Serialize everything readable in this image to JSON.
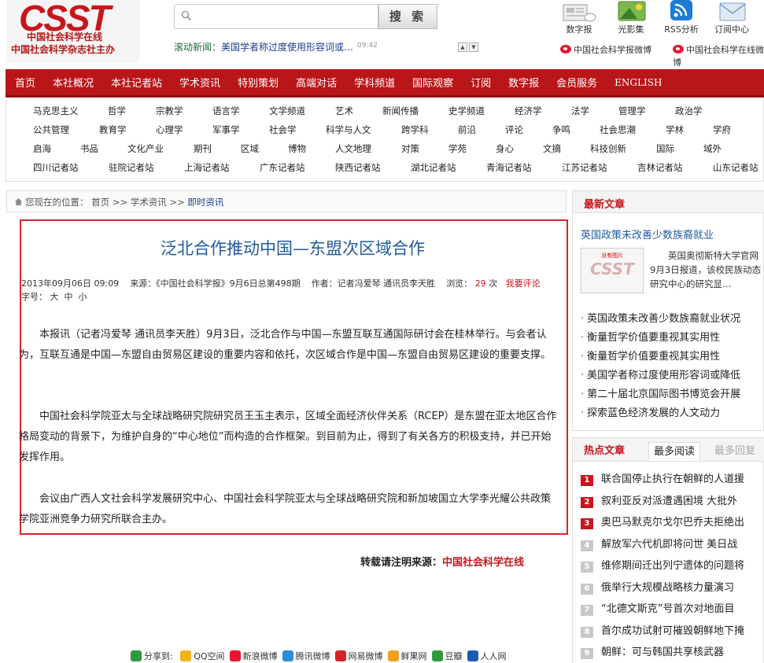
{
  "header": {
    "logo_text": "CSST",
    "logo_sub1": "中国社会科学在线",
    "logo_sub2": "中国社会科学杂志社主办",
    "search_placeholder": "",
    "search_button": "搜 索",
    "ticker_label": "滚动新闻：",
    "ticker_text": "美国学者称过度使用形容词或…",
    "ticker_time": "09:42",
    "top_icons": [
      {
        "icon": "newspaper-icon",
        "label": "数字报"
      },
      {
        "icon": "photo-icon",
        "label": "光影集"
      },
      {
        "icon": "rss-icon",
        "label": "RSS分析"
      },
      {
        "icon": "mail-icon",
        "label": "订阅中心"
      }
    ],
    "weibo_links": [
      "中国社会科学报微博",
      "中国社会科学在线微博"
    ]
  },
  "main_nav": [
    "首页",
    "本社概况",
    "本社记者站",
    "学术资讯",
    "特别策划",
    "高端对话",
    "学科频道",
    "国际观察",
    "订阅",
    "数字报",
    "会员服务",
    "ENGLISH"
  ],
  "sub_nav": {
    "row1": [
      "马克思主义",
      "哲学",
      "宗教学",
      "语言学",
      "文学频道",
      "艺术",
      "新闻传播",
      "史学频道",
      "经济学",
      "法学",
      "管理学",
      "政治学"
    ],
    "row2": [
      "公共管理",
      "教育学",
      "心理学",
      "军事学",
      "社会学",
      "科学与人文",
      "跨学科",
      "前沿",
      "评论",
      "争鸣",
      "社会思潮",
      "学林",
      "学府"
    ],
    "row3": [
      "启海",
      "书品",
      "文化产业",
      "期刊",
      "区域",
      "博物",
      "人文地理",
      "对策",
      "学苑",
      "身心",
      "文摘",
      "科技创新",
      "国际",
      "域外"
    ],
    "row4": [
      "四川记者站",
      "驻院记者站",
      "上海记者站",
      "广东记者站",
      "陕西记者站",
      "湖北记者站",
      "青海记者站",
      "江苏记者站",
      "吉林记者站",
      "山东记者站"
    ]
  },
  "breadcrumb": {
    "prefix": "您现在的位置：",
    "home": "首页",
    "sep1": ">>",
    "section": "学术资讯",
    "sep2": ">>",
    "current": "即时资讯"
  },
  "article": {
    "title": "泛北合作推动中国—东盟次区域合作",
    "date": "2013年09月06日 09:09",
    "source": "来源：《中国社会科学报》9月6日总第498期",
    "author": "作者：记者冯爱琴 通讯员李天胜",
    "views_label": "浏览：",
    "views": "29",
    "views_unit": "次",
    "comment_link": "我要评论",
    "fontsize_label": "字号：",
    "fontsize_options": [
      "大",
      "中",
      "小"
    ],
    "paragraphs": [
      "本报讯（记者冯爱琴 通讯员李天胜）9月3日，泛北合作与中国—东盟互联互通国际研讨会在桂林举行。与会者认为，互联互通是中国—东盟自由贸易区建设的重要内容和依托，次区域合作是中国—东盟自由贸易区建设的重要支撑。",
      "中国社会科学院亚太与全球战略研究院研究员王玉主表示，区域全面经济伙伴关系（RCEP）是东盟在亚太地区合作格局变动的背景下，为维护自身的“中心地位”而构造的合作框架。到目前为止，得到了有关各方的积极支持，并已开始发挥作用。",
      "会议由广西人文社会科学发展研究中心、中国社会科学院亚太与全球战略研究院和新加坡国立大学李光耀公共政策学院亚洲竞争力研究所联合主办。"
    ],
    "repost_label": "转载请注明来源：",
    "repost_source": "中国社会科学在线"
  },
  "share": {
    "label": "分享到:",
    "items": [
      {
        "name": "QQ空间",
        "color": "#f2b315"
      },
      {
        "name": "新浪微博",
        "color": "#e6162d"
      },
      {
        "name": "腾讯微博",
        "color": "#2b8ed6"
      },
      {
        "name": "网易微博",
        "color": "#d5242b"
      },
      {
        "name": "鲜果网",
        "color": "#f0a020"
      },
      {
        "name": "豆瓣",
        "color": "#2f9a3b"
      },
      {
        "name": "人人网",
        "color": "#1b5cae"
      }
    ]
  },
  "latest": {
    "title": "最新文章",
    "featured_title": "英国政策未改善少数族裔就业",
    "thumb_text": "没有图片",
    "thumb_logo": "CSST",
    "featured_desc": "英国奥彻斯特大学官网9月3日报道，该校民族动态研究中心的研究显…",
    "items": [
      "英国政策未改善少数族裔就业状况",
      "衡量哲学价值要重视其实用性",
      "衡量哲学价值要重视其实用性",
      "美国学者称过度使用形容词或降低",
      "第二十届北京国际图书博览会开展",
      "探索蓝色经济发展的人文动力"
    ]
  },
  "hot": {
    "title": "热点文章",
    "tabs": [
      "最多阅读",
      "最多回复"
    ],
    "items": [
      "联合国停止执行在朝鲜的人道援",
      "叙利亚反对派遭遇困境 大批外",
      "奥巴马默克尔戈尔巴乔夫拒绝出",
      "解放军六代机即将问世 美日战",
      "维修期间迁出列宁遗体的问题将",
      "俄举行大规模战略核力量演习",
      "“北德文斯克”号首次对地面目",
      "首尔成功试射可摧毁朝鲜地下掩",
      "朝鲜：可与韩国共享核武器"
    ],
    "nums": [
      "1",
      "2",
      "3",
      "4",
      "5",
      "6",
      "7",
      "8",
      "9"
    ]
  },
  "colors": {
    "brand_red": "#b91619",
    "link_blue": "#1f5a9e",
    "box_red": "#d7262c"
  }
}
